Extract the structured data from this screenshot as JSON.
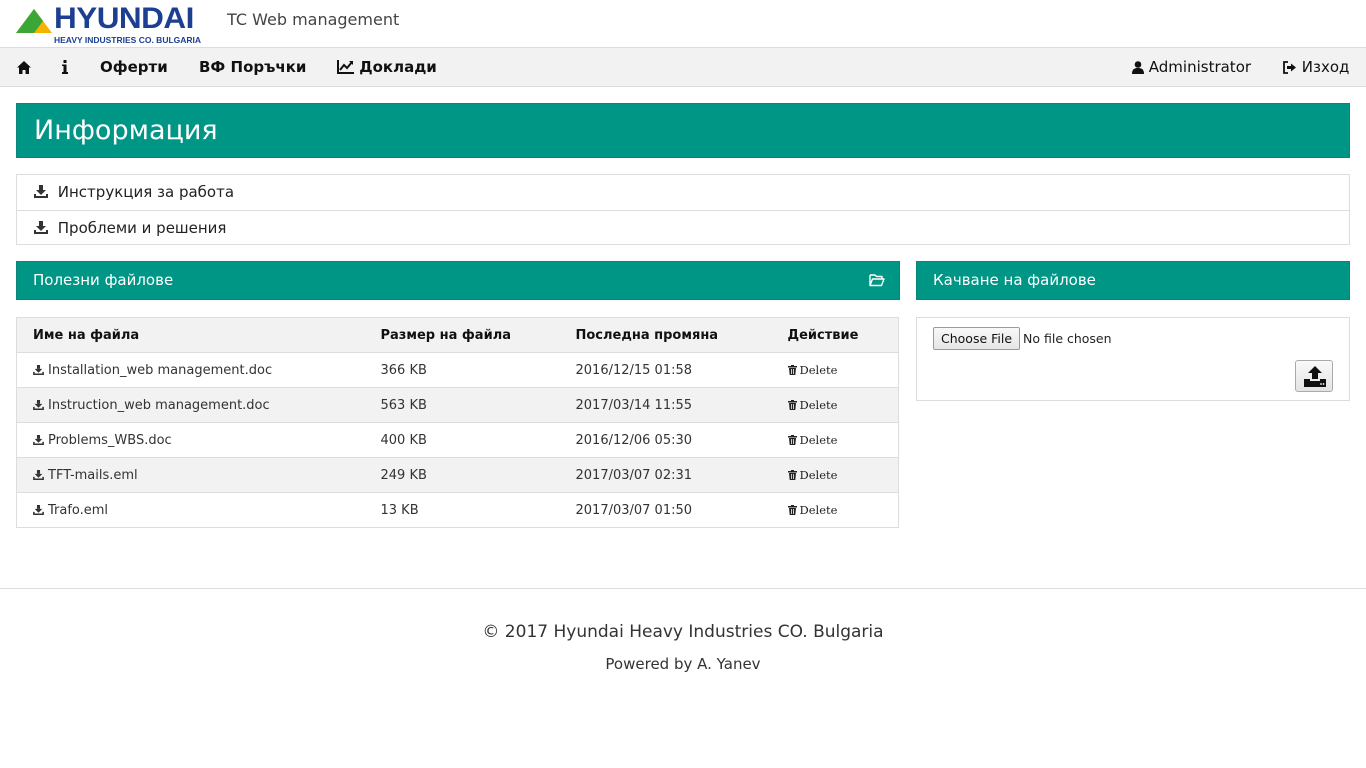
{
  "header": {
    "logo_word": "HYUNDAI",
    "logo_sub": "HEAVY INDUSTRIES CO. BULGARIA",
    "app_title": "TC Web management"
  },
  "nav": {
    "home_icon": "home-icon",
    "info_icon": "info-icon",
    "offers": "Оферти",
    "orders": "ВФ Поръчки",
    "reports": "Доклади",
    "user": "Administrator",
    "logout": "Изход"
  },
  "page_title": "Информация",
  "docs": [
    {
      "label": "Инструкция за работа",
      "icon": "download-icon"
    },
    {
      "label": "Проблеми и решения",
      "icon": "download-icon"
    }
  ],
  "files_panel": {
    "title": "Полезни файлове",
    "icon": "folder-open-icon",
    "columns": [
      "Име на файла",
      "Размер на файла",
      "Последна промяна",
      "Действие"
    ],
    "rows": [
      {
        "name": "Installation_web management.doc",
        "size": "366 KB",
        "modified": "2016/12/15 01:58",
        "action": "Delete"
      },
      {
        "name": "Instruction_web management.doc",
        "size": "563 KB",
        "modified": "2017/03/14 11:55",
        "action": "Delete"
      },
      {
        "name": "Problems_WBS.doc",
        "size": "400 KB",
        "modified": "2016/12/06 05:30",
        "action": "Delete"
      },
      {
        "name": "TFT-mails.eml",
        "size": "249 KB",
        "modified": "2017/03/07 02:31",
        "action": "Delete"
      },
      {
        "name": "Trafo.eml",
        "size": "13 KB",
        "modified": "2017/03/07 01:50",
        "action": "Delete"
      }
    ]
  },
  "upload_panel": {
    "title": "Качване на файлове",
    "choose_label": "Choose File",
    "status": "No file chosen",
    "upload_icon": "upload-icon"
  },
  "footer": {
    "copyright": "© 2017 Hyundai Heavy Industries CO. Bulgaria",
    "powered": "Powered by A. Yanev"
  },
  "colors": {
    "accent": "#009685",
    "brand": "#1d3f91"
  }
}
